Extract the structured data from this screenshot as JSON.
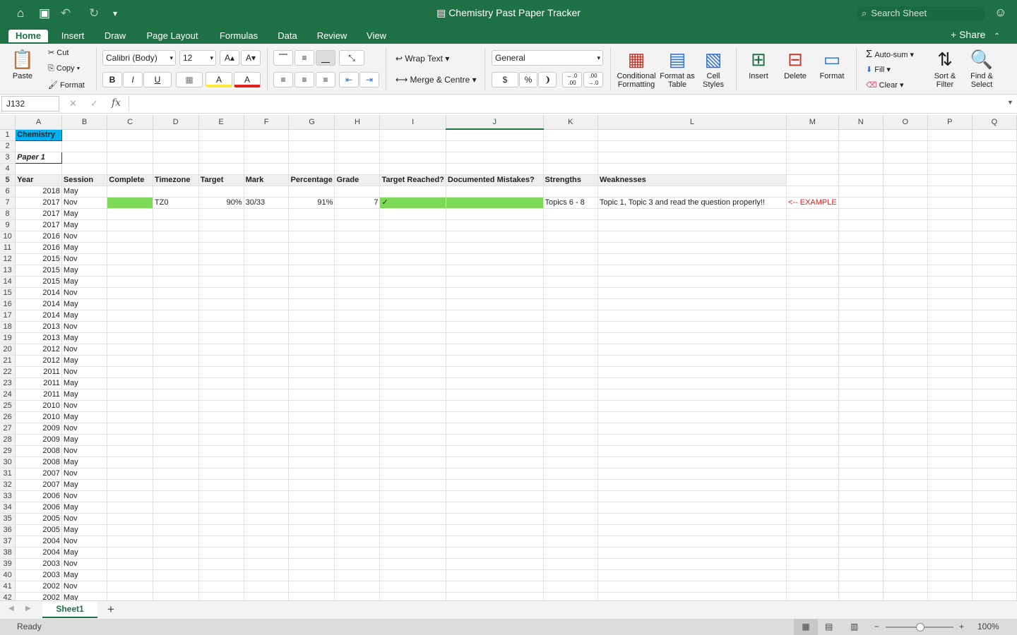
{
  "titlebar": {
    "title": "Chemistry Past Paper Tracker",
    "search_placeholder": "Search Sheet",
    "home_icon": "⌂",
    "save_icon": "▣",
    "undo_icon": "↶",
    "redo_icon": "↻",
    "customize_icon": "▾",
    "user_icon": "☺",
    "doc_icon": "▤",
    "search_icon": "⌕"
  },
  "tabs": [
    "Home",
    "Insert",
    "Draw",
    "Page Layout",
    "Formulas",
    "Data",
    "Review",
    "View"
  ],
  "share_label": "Share",
  "share_icon": "+",
  "ribbon": {
    "paste": "Paste",
    "cut": "Cut",
    "copy": "Copy",
    "format": "Format",
    "font_name": "Calibri (Body)",
    "font_size": "12",
    "increase_font": "A▴",
    "decrease_font": "A▾",
    "bold": "B",
    "italic": "I",
    "underline": "U",
    "wrap_text": "Wrap Text",
    "merge_centre": "Merge & Centre",
    "number_format": "General",
    "currency": "$",
    "percent": "%",
    "comma": "❩",
    "inc_decimal": "←.0\n.00",
    "dec_decimal": ".00\n→.0",
    "cond_formatting": "Conditional Formatting",
    "format_as_table": "Format as Table",
    "cell_styles": "Cell Styles",
    "insert": "Insert",
    "delete": "Delete",
    "format_cells": "Format",
    "auto_sum": "Auto-sum",
    "fill": "Fill",
    "clear": "Clear",
    "sort_filter": "Sort & Filter",
    "find_select": "Find & Select",
    "icons": {
      "paste": "📋",
      "cut": "✂",
      "copy": "⎘",
      "format_painter": "🖌",
      "fill_color": "A",
      "font_color": "A",
      "sigma": "Σ",
      "fill_down": "⬇",
      "eraser": "⌫",
      "sort": "⇅",
      "find": "🔍",
      "cond": "▦",
      "table": "▤",
      "styles": "▧",
      "insert_cells": "⊞",
      "delete_cells": "⊟",
      "format_cells": "▭",
      "border": "▦",
      "align_top": "⎺",
      "align_middle": "≡",
      "align_bottom": "⎽",
      "orientation": "⤡",
      "align_left": "≡",
      "align_center": "≡",
      "align_right": "≡",
      "outdent": "⇤",
      "indent": "⇥",
      "wrap": "↩",
      "merge": "⟷",
      "dropdown": "▾"
    }
  },
  "formula_bar": {
    "name_box": "J132",
    "fx": "fx",
    "cancel_icon": "✕",
    "confirm_icon": "✓",
    "value": ""
  },
  "grid": {
    "columns": [
      "A",
      "B",
      "C",
      "D",
      "E",
      "F",
      "G",
      "H",
      "I",
      "J",
      "K",
      "L",
      "M",
      "N",
      "O",
      "P",
      "Q"
    ],
    "selected_column": "J",
    "title_cell": "Chemistry",
    "paper_cell": "Paper 1",
    "headers": [
      "Year",
      "Session",
      "Complete",
      "Timezone",
      "Target",
      "Mark",
      "Percentage",
      "Grade",
      "Target Reached?",
      "Documented Mistakes?",
      "Strengths",
      "Weaknesses"
    ],
    "example_row": {
      "year": "2017",
      "session": "Nov",
      "timezone": "TZ0",
      "target": "90%",
      "mark": "30/33",
      "percentage": "91%",
      "grade": "7",
      "target_reached": "✓",
      "strengths": "Topics 6 - 8",
      "weaknesses": "Topic 1, Topic 3 and read the question properly!!",
      "example_note": "<-- EXAMPLE",
      "note_color": "#e02020"
    },
    "rows": [
      {
        "year": "2018",
        "session": "May"
      },
      {
        "year": "2017",
        "session": "Nov"
      },
      {
        "year": "2017",
        "session": "May"
      },
      {
        "year": "2017",
        "session": "May"
      },
      {
        "year": "2016",
        "session": "Nov"
      },
      {
        "year": "2016",
        "session": "May"
      },
      {
        "year": "2015",
        "session": "Nov"
      },
      {
        "year": "2015",
        "session": "May"
      },
      {
        "year": "2015",
        "session": "May"
      },
      {
        "year": "2014",
        "session": "Nov"
      },
      {
        "year": "2014",
        "session": "May"
      },
      {
        "year": "2014",
        "session": "May"
      },
      {
        "year": "2013",
        "session": "Nov"
      },
      {
        "year": "2013",
        "session": "May"
      },
      {
        "year": "2012",
        "session": "Nov"
      },
      {
        "year": "2012",
        "session": "May"
      },
      {
        "year": "2011",
        "session": "Nov"
      },
      {
        "year": "2011",
        "session": "May"
      },
      {
        "year": "2011",
        "session": "May"
      },
      {
        "year": "2010",
        "session": "Nov"
      },
      {
        "year": "2010",
        "session": "May"
      },
      {
        "year": "2009",
        "session": "Nov"
      },
      {
        "year": "2009",
        "session": "May"
      },
      {
        "year": "2008",
        "session": "Nov"
      },
      {
        "year": "2008",
        "session": "May"
      },
      {
        "year": "2007",
        "session": "Nov"
      },
      {
        "year": "2007",
        "session": "May"
      },
      {
        "year": "2006",
        "session": "Nov"
      },
      {
        "year": "2006",
        "session": "May"
      },
      {
        "year": "2005",
        "session": "Nov"
      },
      {
        "year": "2005",
        "session": "May"
      },
      {
        "year": "2004",
        "session": "Nov"
      },
      {
        "year": "2004",
        "session": "May"
      },
      {
        "year": "2003",
        "session": "Nov"
      },
      {
        "year": "2003",
        "session": "May"
      },
      {
        "year": "2002",
        "session": "Nov"
      },
      {
        "year": "2002",
        "session": "May"
      }
    ],
    "accent_green": "#7ed957",
    "title_fill": "#00b0f0"
  },
  "sheets": {
    "active": "Sheet1",
    "add_icon": "+",
    "prev_icon": "◀",
    "next_icon": "▶"
  },
  "status": {
    "mode": "Ready",
    "zoom": "100%",
    "zoom_out": "−",
    "zoom_in": "+",
    "view_normal_icon": "▦",
    "view_layout_icon": "▤",
    "view_break_icon": "▥"
  }
}
